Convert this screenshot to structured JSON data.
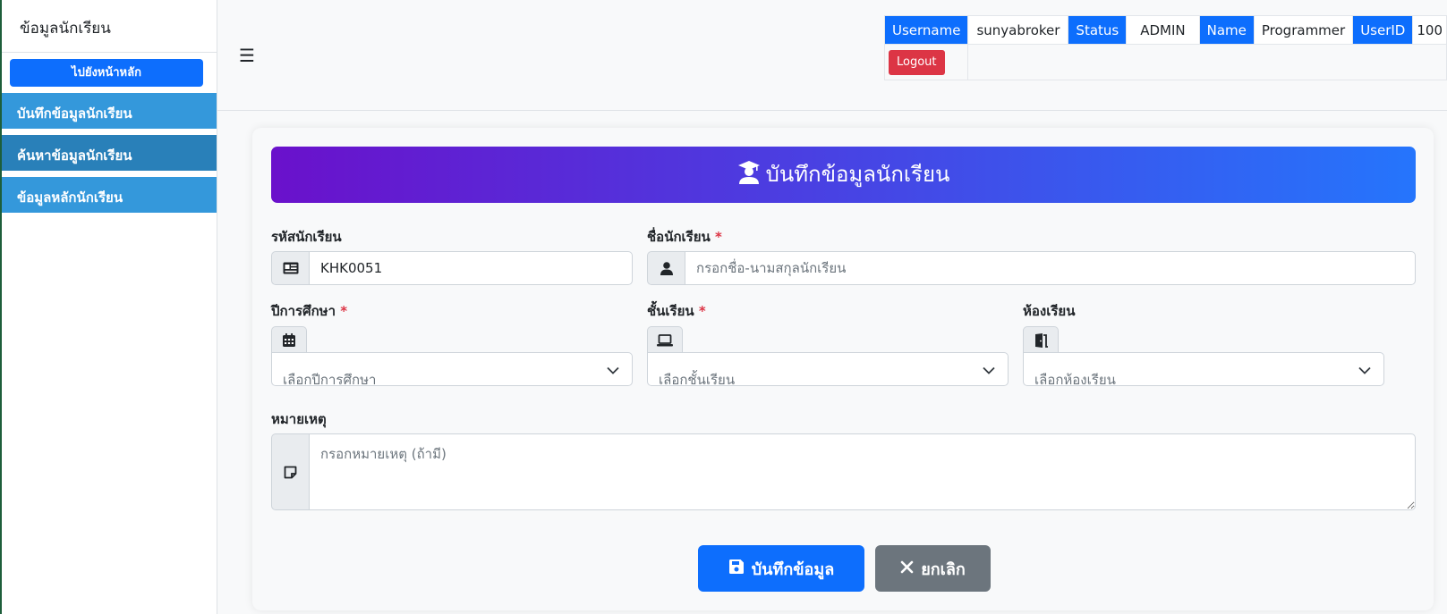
{
  "sidebar": {
    "title": "ข้อมูลนักเรียน",
    "home_button": "ไปยังหน้าหลัก",
    "items": [
      {
        "label": "บันทึกข้อมูลนักเรียน"
      },
      {
        "label": "ค้นหาข้อมูลนักเรียน"
      },
      {
        "label": "ข้อมูลหลักนักเรียน"
      }
    ]
  },
  "header": {
    "menu_icon": "hamburger-icon",
    "username_label": "Username",
    "username_value": "sunyabroker",
    "status_label": "Status",
    "status_value": "ADMIN",
    "name_label": "Name",
    "name_value": "Programmer",
    "userid_label": "UserID",
    "userid_value": "100",
    "logout_label": "Logout"
  },
  "form": {
    "title": "บันทึกข้อมูลนักเรียน",
    "student_id": {
      "label": "รหัสนักเรียน",
      "value": "KHK0051",
      "icon": "id-card-icon"
    },
    "student_name": {
      "label": "ชื่อนักเรียน",
      "required": "*",
      "placeholder": "กรอกชื่อ-นามสกุลนักเรียน",
      "icon": "user-icon"
    },
    "academic_year": {
      "label": "ปีการศึกษา",
      "required": "*",
      "selected": "เลือกปีการศึกษา",
      "icon": "calendar-icon"
    },
    "grade": {
      "label": "ชั้นเรียน",
      "required": "*",
      "selected": "เลือกชั้นเรียน",
      "icon": "laptop-icon"
    },
    "classroom": {
      "label": "ห้องเรียน",
      "selected": "เลือกห้องเรียน",
      "icon": "door-icon"
    },
    "note": {
      "label": "หมายเหตุ",
      "placeholder": "กรอกหมายเหตุ (ถ้ามี)",
      "icon": "sticky-note-icon"
    },
    "save_button": "บันทึกข้อมูล",
    "cancel_button": "ยกเลิก"
  },
  "colors": {
    "primary": "#0d6efd",
    "sidebar_item": "#3498db",
    "sidebar_item_active": "#2980b9",
    "danger": "#dc3545",
    "secondary": "#6c757d",
    "gradient_start": "#6a11cb",
    "gradient_end": "#2575fc"
  }
}
